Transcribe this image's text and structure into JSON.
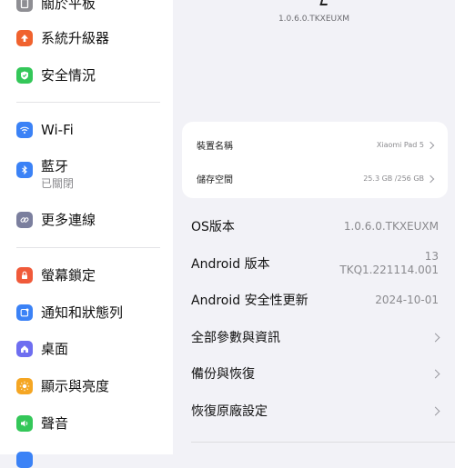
{
  "sidebar": {
    "items": [
      {
        "label": "關於平板",
        "sub": "",
        "icon": "tablet-icon",
        "color": "#8e8e93"
      },
      {
        "label": "系統升級器",
        "sub": "",
        "icon": "upgrade-arrow-icon",
        "color": "#f0622e"
      },
      {
        "label": "安全情況",
        "sub": "",
        "icon": "shield-check-icon",
        "color": "#34c759"
      },
      {
        "label": "Wi-Fi",
        "sub": "",
        "icon": "wifi-icon",
        "color": "#3b82f6"
      },
      {
        "label": "藍牙",
        "sub": "已關閉",
        "icon": "bluetooth-icon",
        "color": "#3b82f6"
      },
      {
        "label": "更多連線",
        "sub": "",
        "icon": "link-icon",
        "color": "#7b7f9e"
      },
      {
        "label": "螢幕鎖定",
        "sub": "",
        "icon": "lock-icon",
        "color": "#f05a3a"
      },
      {
        "label": "通知和狀態列",
        "sub": "",
        "icon": "notification-icon",
        "color": "#3b82f6"
      },
      {
        "label": "桌面",
        "sub": "",
        "icon": "home-icon",
        "color": "#6e6ef0"
      },
      {
        "label": "顯示與亮度",
        "sub": "",
        "icon": "sun-icon",
        "color": "#f5a623"
      },
      {
        "label": "聲音",
        "sub": "",
        "icon": "speaker-icon",
        "color": "#34c759"
      }
    ]
  },
  "main": {
    "version_top": "1.0.6.0.TKXEUXM",
    "card": [
      {
        "label": "裝置名稱",
        "value": "Xiaomi Pad 5"
      },
      {
        "label": "儲存空間",
        "value": "25.3 GB /256 GB"
      }
    ],
    "rows": [
      {
        "label": "OS版本",
        "value": "1.0.6.0.TKXEUXM"
      },
      {
        "label": "Android 版本",
        "value": "13",
        "value2": "TKQ1.221114.001"
      },
      {
        "label": "Android 安全性更新",
        "value": "2024-10-01"
      },
      {
        "label": "全部參數與資訊",
        "value": ""
      },
      {
        "label": "備份與恢復",
        "value": ""
      },
      {
        "label": "恢復原廠設定",
        "value": ""
      }
    ]
  }
}
